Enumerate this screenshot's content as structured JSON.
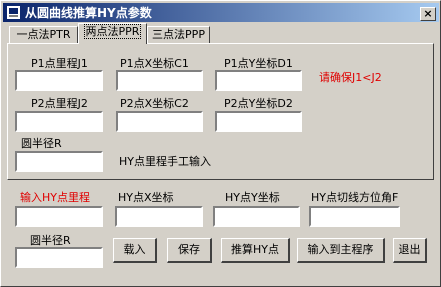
{
  "window": {
    "title": "从圆曲线推算HY点参数",
    "close_label": "×"
  },
  "tabs": [
    {
      "label": "一点法PTR"
    },
    {
      "label": "两点法PPR"
    },
    {
      "label": "三点法PPP"
    }
  ],
  "panel": {
    "p1_mileage_label": "P1点里程J1",
    "p1_x_label": "P1点X坐标C1",
    "p1_y_label": "P1点Y坐标D1",
    "p1_mileage_value": "",
    "p1_x_value": "",
    "p1_y_value": "",
    "warning": "请确保J1<J2",
    "p2_mileage_label": "P2点里程J2",
    "p2_x_label": "P2点X坐标C2",
    "p2_y_label": "P2点Y坐标D2",
    "p2_mileage_value": "",
    "p2_x_value": "",
    "p2_y_value": "",
    "radius_label": "圆半径R",
    "radius_value": "",
    "hy_manual_note": "HY点里程手工输入"
  },
  "output": {
    "hy_mileage_label": "输入HY点里程",
    "hy_x_label": "HY点X坐标",
    "hy_y_label": "HY点Y坐标",
    "hy_bearing_label": "HY点切线方位角F",
    "hy_mileage_value": "",
    "hy_x_value": "",
    "hy_y_value": "",
    "hy_bearing_value": "",
    "radius_label": "圆半径R",
    "radius_value": ""
  },
  "buttons": {
    "load": "载入",
    "save": "保存",
    "compute": "推算HY点",
    "send_to_main": "输入到主程序",
    "exit": "退出"
  },
  "colors": {
    "titlebar_start": "#0a246a",
    "titlebar_end": "#a6caf0",
    "face": "#d4d0c8",
    "highlight_text": "#e00000"
  }
}
